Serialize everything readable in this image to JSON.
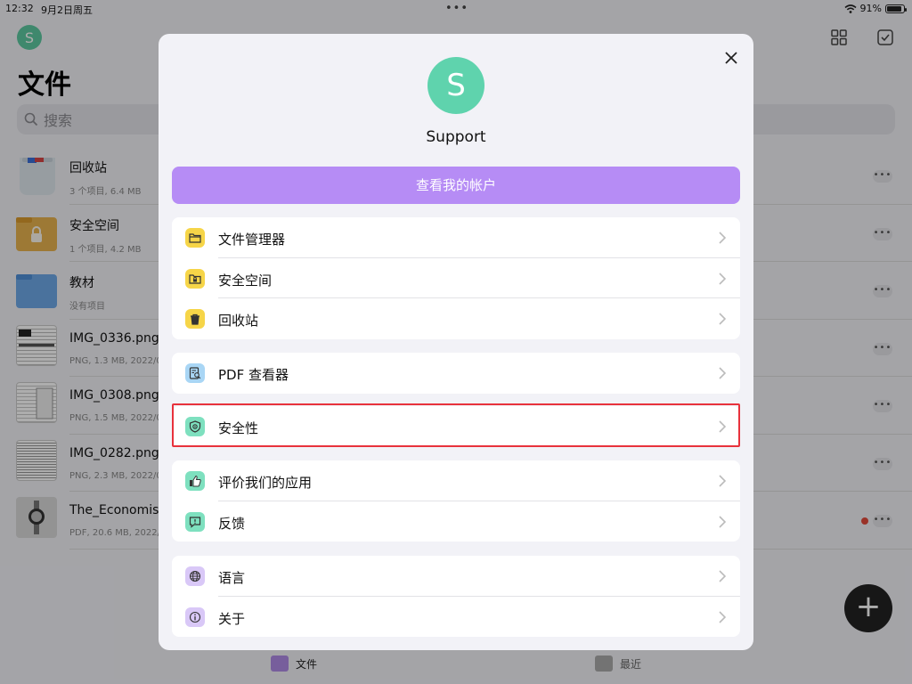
{
  "status_bar": {
    "time": "12:32",
    "date": "9月2日周五",
    "battery": "91%",
    "battery_level": 0.91
  },
  "header": {
    "avatar_letter": "S",
    "title": "文件"
  },
  "search": {
    "placeholder": "搜索"
  },
  "files": [
    {
      "name": "回收站",
      "meta": "3 个项目, 6.4 MB",
      "icon": "trash-icon"
    },
    {
      "name": "安全空间",
      "meta": "1 个项目, 4.2 MB",
      "icon": "locked-folder-icon"
    },
    {
      "name": "教材",
      "meta": "没有项目",
      "icon": "folder-icon"
    },
    {
      "name": "IMG_0336.png",
      "meta": "PNG, 1.3 MB, 2022/0",
      "icon": "image-thumbnail"
    },
    {
      "name": "IMG_0308.png",
      "meta": "PNG, 1.5 MB, 2022/0",
      "icon": "image-thumbnail"
    },
    {
      "name": "IMG_0282.png",
      "meta": "PNG, 2.3 MB, 2022/0",
      "icon": "image-thumbnail"
    },
    {
      "name": "The_Economist",
      "meta": "PDF, 20.6 MB, 2022/",
      "icon": "pdf-thumbnail"
    }
  ],
  "tabbar": {
    "files_label": "文件",
    "recent_label": "最近"
  },
  "modal": {
    "avatar_letter": "S",
    "username": "Support",
    "account_button": "查看我的帐户",
    "groups": [
      [
        {
          "label": "文件管理器",
          "icon": "folder-icon"
        },
        {
          "label": "安全空间",
          "icon": "lock-folder-icon"
        },
        {
          "label": "回收站",
          "icon": "trash-icon"
        }
      ],
      [
        {
          "label": "PDF 查看器",
          "icon": "pdf-viewer-icon"
        }
      ],
      [
        {
          "label": "安全性",
          "icon": "shield-icon"
        }
      ],
      [
        {
          "label": "评价我们的应用",
          "icon": "thumbs-up-icon"
        },
        {
          "label": "反馈",
          "icon": "feedback-icon"
        }
      ],
      [
        {
          "label": "语言",
          "icon": "globe-icon"
        },
        {
          "label": "关于",
          "icon": "info-icon"
        }
      ]
    ]
  },
  "colors": {
    "accent_purple": "#b68cf5",
    "avatar_green": "#5fd3ad",
    "icon_yellow": "#f6d548",
    "icon_blue": "#a9d6f5",
    "icon_green": "#7ee0bf",
    "icon_lavender": "#d9c8f7",
    "highlight_red": "#e8323c"
  }
}
